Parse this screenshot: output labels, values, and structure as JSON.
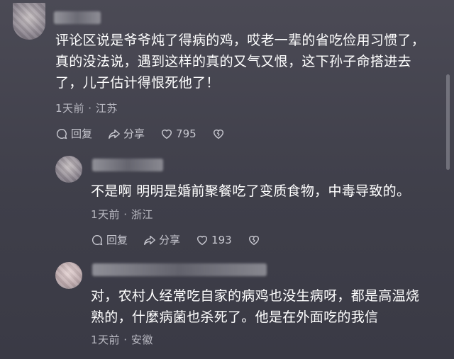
{
  "comments": [
    {
      "text_lines": [
        "评论区说是爷爷炖了得病的鸡，哎老一辈的省吃俭用习惯了，",
        "真的没法说，遇到这样的真的又气又恨，这下孙子命搭进去",
        "了，儿子估计得恨死他了！"
      ],
      "meta": "1天前 · 江苏",
      "reply_label": "回复",
      "share_label": "分享",
      "likes": "795"
    },
    {
      "text_lines": [
        "不是啊 明明是婚前聚餐吃了变质食物，中毒导致的。"
      ],
      "meta": "1天前 · 浙江",
      "reply_label": "回复",
      "share_label": "分享",
      "likes": "193"
    },
    {
      "text_lines": [
        "对，农村人经常吃自家的病鸡也没生病呀，都是高温烧",
        "熟的，什麼病菌也杀死了。他是在外面吃的我信"
      ],
      "meta": "1天前 · 安徽"
    }
  ]
}
